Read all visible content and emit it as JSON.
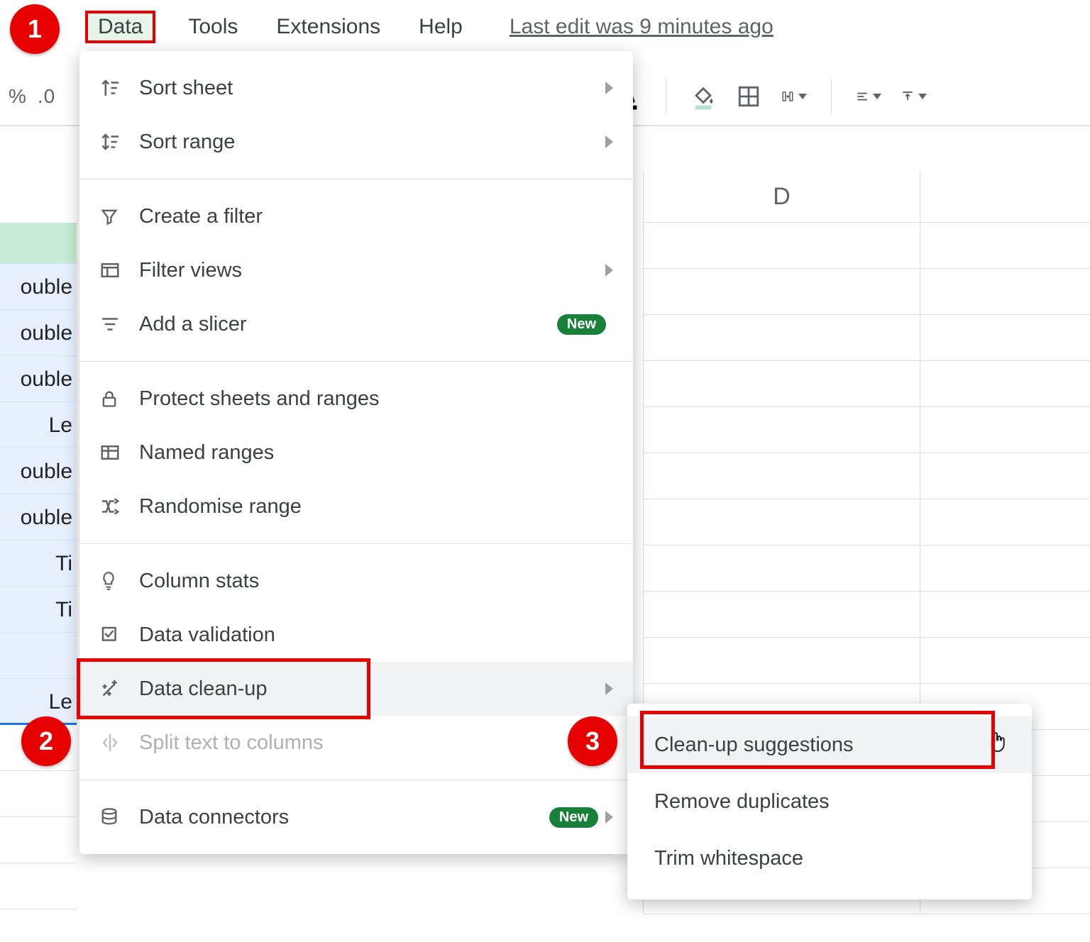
{
  "menubar": {
    "data": "Data",
    "tools": "Tools",
    "extensions": "Extensions",
    "help": "Help",
    "last_edit": "Last edit was 9 minutes ago"
  },
  "toolbar_left": {
    "percent": "%",
    "dec_less": ".0"
  },
  "column_header": {
    "d": "D"
  },
  "leftcol": [
    "",
    "ouble",
    "ouble",
    "ouble",
    "Le",
    "ouble",
    "ouble",
    "Ti",
    "Ti",
    "",
    "Le"
  ],
  "data_menu": {
    "sort_sheet": "Sort sheet",
    "sort_range": "Sort range",
    "create_filter": "Create a filter",
    "filter_views": "Filter views",
    "add_slicer": "Add a slicer",
    "protect": "Protect sheets and ranges",
    "named_ranges": "Named ranges",
    "randomise": "Randomise range",
    "column_stats": "Column stats",
    "data_validation": "Data validation",
    "data_cleanup": "Data clean-up",
    "split_text": "Split text to columns",
    "data_connectors": "Data connectors",
    "new_pill": "New"
  },
  "submenu": {
    "cleanup_suggestions": "Clean-up suggestions",
    "remove_duplicates": "Remove duplicates",
    "trim_whitespace": "Trim whitespace"
  },
  "callouts": {
    "one": "1",
    "two": "2",
    "three": "3"
  }
}
